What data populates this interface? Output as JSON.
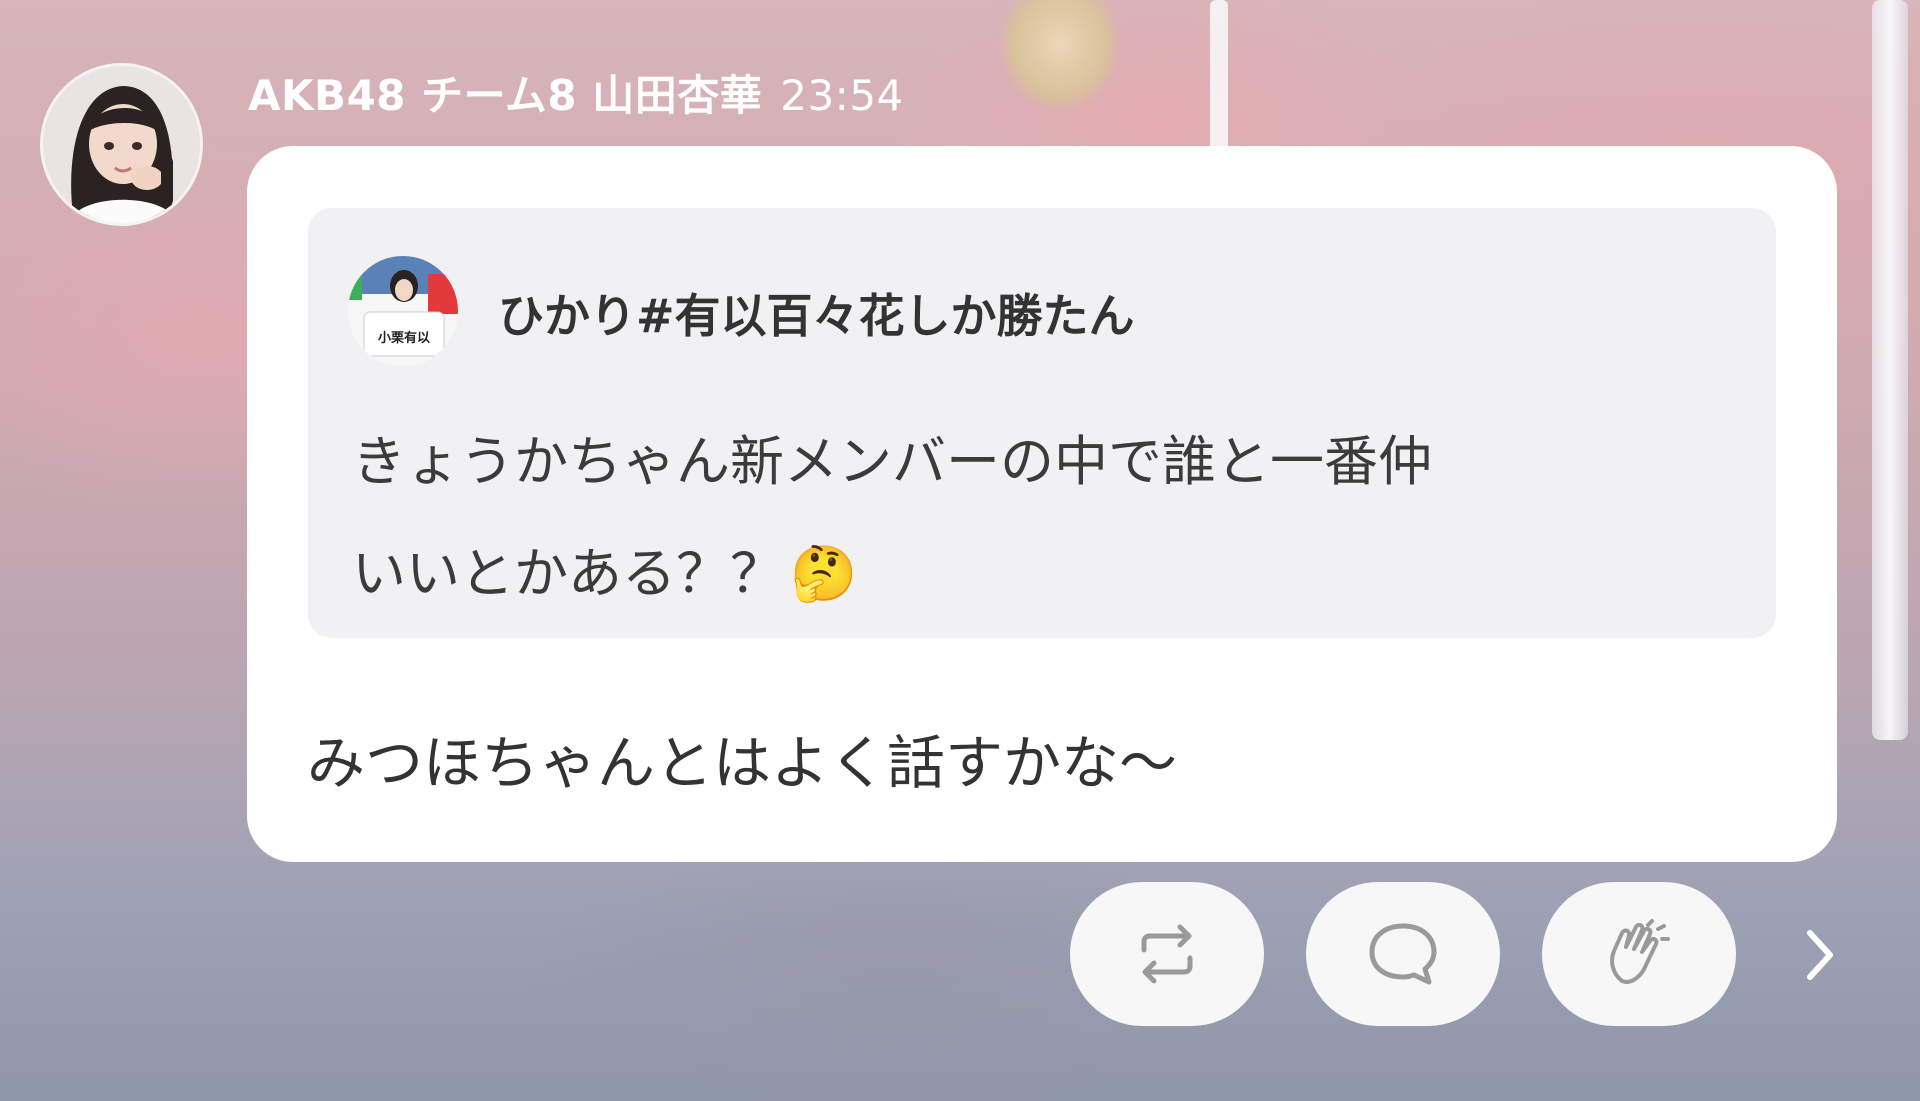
{
  "post": {
    "author": "AKB48 チーム8 山田杏華",
    "time": "23:54",
    "avatar_icon": "member-avatar-icon"
  },
  "quote": {
    "sender": "ひかり#有以百々花しか勝たん",
    "avatar_icon": "sender-avatar-icon",
    "sender_avatar_text": "小栗有以",
    "message_lines": [
      "きょうかちゃん新メンバーの中で誰と一番仲",
      "いいとかある？？"
    ],
    "emoji": "🤔"
  },
  "reply": {
    "text": "みつほちゃんとはよく話すかな〜"
  },
  "actions": [
    {
      "icon": "repost-icon"
    },
    {
      "icon": "comment-icon"
    },
    {
      "icon": "clap-icon"
    }
  ],
  "next_icon": "chevron-right-icon",
  "colors": {
    "bubble": "#ffffff",
    "quote_bg": "#f1f1f3",
    "text": "#333333",
    "button_bg": "#f7f7f7",
    "icon": "#9a9a9a"
  }
}
